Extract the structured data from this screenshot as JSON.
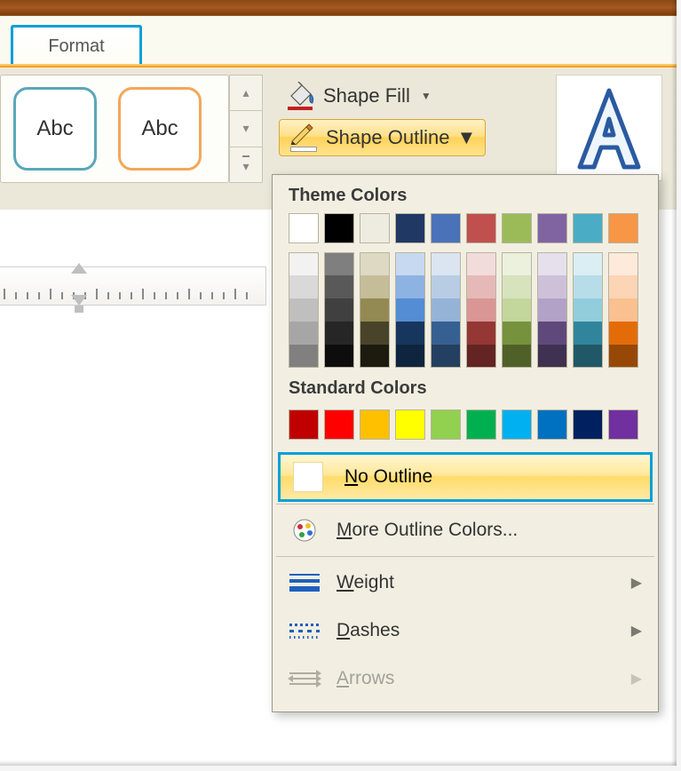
{
  "tab": {
    "format": "Format"
  },
  "gallery": {
    "thumb_text": "Abc"
  },
  "buttons": {
    "shape_fill": "Shape Fill",
    "shape_outline": "Shape Outline"
  },
  "dropdown": {
    "theme_colors_title": "Theme Colors",
    "standard_colors_title": "Standard Colors",
    "no_outline": "No Outline",
    "more_colors": "More Outline Colors...",
    "weight": "Weight",
    "dashes": "Dashes",
    "arrows": "Arrows"
  },
  "theme_colors": [
    "#ffffff",
    "#000000",
    "#eeece1",
    "#1f3864",
    "#4a72b8",
    "#c0504d",
    "#9bbb59",
    "#8064a2",
    "#4bacc6",
    "#f79646"
  ],
  "theme_tints": [
    [
      "#f2f2f2",
      "#7f7f7f",
      "#ddd9c3",
      "#c6d9f0",
      "#dbe5f1",
      "#f2dcdb",
      "#ebf1dd",
      "#e5e0ec",
      "#dbeef3",
      "#fdeada"
    ],
    [
      "#d9d9d9",
      "#595959",
      "#c4bd97",
      "#8db3e2",
      "#b8cce4",
      "#e5b9b7",
      "#d7e3bc",
      "#ccc1d9",
      "#b7dde8",
      "#fbd5b5"
    ],
    [
      "#bfbfbf",
      "#404040",
      "#938953",
      "#548dd4",
      "#95b3d7",
      "#d99694",
      "#c3d69b",
      "#b2a2c7",
      "#92cddc",
      "#fac08f"
    ],
    [
      "#a6a6a6",
      "#262626",
      "#494429",
      "#17365d",
      "#366092",
      "#953734",
      "#76923c",
      "#5f497a",
      "#31859b",
      "#e36c09"
    ],
    [
      "#808080",
      "#0d0d0d",
      "#1d1b10",
      "#0f243e",
      "#244061",
      "#632423",
      "#4f6128",
      "#3f3151",
      "#205867",
      "#974806"
    ]
  ],
  "standard_colors": [
    "#c00000",
    "#ff0000",
    "#ffc000",
    "#ffff00",
    "#92d050",
    "#00b050",
    "#00b0f0",
    "#0070c0",
    "#002060",
    "#7030a0"
  ]
}
